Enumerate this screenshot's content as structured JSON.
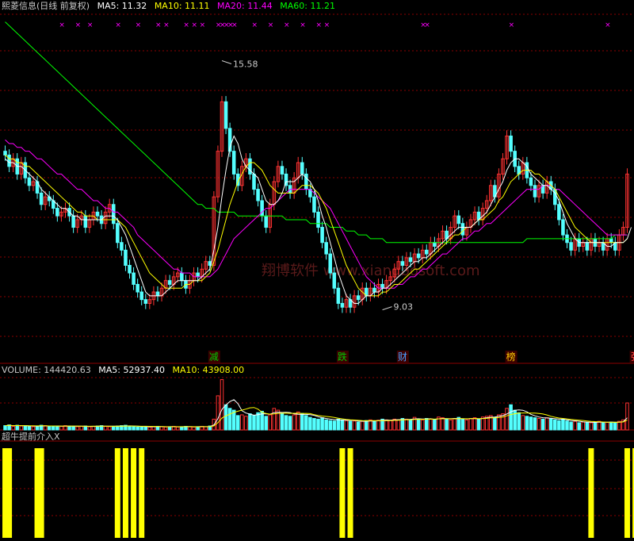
{
  "header": {
    "title": "熙菱信息(日线 前复权)",
    "ma5_label": "MA5: 11.32",
    "ma10_label": "MA10: 11.11",
    "ma20_label": "MA20: 11.44",
    "ma60_label": "MA60: 11.21"
  },
  "volume_header": {
    "label": "VOLUME: 144420.63",
    "ma5_label": "MA5: 52937.40",
    "ma10_label": "MA10: 43908.00"
  },
  "indicator_header": {
    "label": "超牛提前介入X"
  },
  "watermark": "翔博软件 www.xiangbosoft.com",
  "tags": [
    {
      "text": "减",
      "color": "#00cc00",
      "bg": "#3a0000",
      "x_index": 52
    },
    {
      "text": "跌",
      "color": "#00cc00",
      "bg": "#3a0000",
      "x_index": 84
    },
    {
      "text": "财",
      "color": "#4aa0ff",
      "bg": "#3a0000",
      "x_index": 99
    },
    {
      "text": "榜",
      "color": "#ffcc00",
      "bg": "#3a0000",
      "x_index": 126
    },
    {
      "text": "张",
      "color": "#ff4040",
      "bg": "#3a0000",
      "x_index": 157
    }
  ],
  "colors": {
    "up": "#ff3232",
    "down": "#54ffff",
    "ma5": "#ffffff",
    "ma10": "#ffff00",
    "ma20": "#ff00ff",
    "ma60": "#00ff00",
    "grid": "#8b0000",
    "signal": "#ffff00",
    "marker": "#ff00ff"
  },
  "chart_data": {
    "type": "candlestick",
    "price_annotations": [
      {
        "text": "15.58",
        "value": 15.58
      },
      {
        "text": "9.03",
        "value": 9.03
      }
    ],
    "ylim": [
      8.0,
      16.8
    ],
    "volume_ylim": [
      0,
      150000
    ],
    "bars": [
      [
        13.2,
        13.1
      ],
      [
        13.1,
        12.8
      ],
      [
        12.8,
        13.0
      ],
      [
        13.0,
        12.6
      ],
      [
        12.6,
        12.9
      ],
      [
        12.9,
        12.5
      ],
      [
        12.5,
        12.3
      ],
      [
        12.3,
        12.4
      ],
      [
        12.4,
        12.1
      ],
      [
        12.1,
        11.8
      ],
      [
        11.8,
        12.0
      ],
      [
        12.0,
        11.9
      ],
      [
        11.9,
        11.7
      ],
      [
        11.7,
        11.5
      ],
      [
        11.5,
        11.6
      ],
      [
        11.6,
        11.7
      ],
      [
        11.7,
        11.5
      ],
      [
        11.5,
        11.2
      ],
      [
        11.2,
        11.4
      ],
      [
        11.4,
        11.5
      ],
      [
        11.5,
        11.2
      ],
      [
        11.2,
        11.4
      ],
      [
        11.4,
        11.6
      ],
      [
        11.6,
        11.5
      ],
      [
        11.5,
        11.3
      ],
      [
        11.3,
        11.6
      ],
      [
        11.6,
        11.8
      ],
      [
        11.8,
        11.3
      ],
      [
        11.3,
        10.8
      ],
      [
        10.8,
        10.6
      ],
      [
        10.6,
        10.2
      ],
      [
        10.2,
        10.0
      ],
      [
        10.0,
        9.7
      ],
      [
        9.7,
        9.5
      ],
      [
        9.5,
        9.3
      ],
      [
        9.3,
        9.2
      ],
      [
        9.2,
        9.3
      ],
      [
        9.3,
        9.5
      ],
      [
        9.5,
        9.4
      ],
      [
        9.4,
        9.6
      ],
      [
        9.6,
        9.8
      ],
      [
        9.8,
        9.7
      ],
      [
        9.7,
        9.9
      ],
      [
        9.9,
        10.0
      ],
      [
        10.0,
        9.8
      ],
      [
        9.8,
        9.6
      ],
      [
        9.6,
        9.8
      ],
      [
        9.8,
        10.0
      ],
      [
        10.0,
        9.9
      ],
      [
        9.9,
        10.1
      ],
      [
        10.1,
        10.3
      ],
      [
        10.3,
        10.2
      ],
      [
        10.2,
        12.0
      ],
      [
        12.0,
        13.2
      ],
      [
        13.2,
        14.5
      ],
      [
        14.5,
        13.8
      ],
      [
        13.8,
        13.2
      ],
      [
        13.2,
        12.6
      ],
      [
        12.6,
        12.3
      ],
      [
        12.3,
        12.8
      ],
      [
        12.8,
        13.0
      ],
      [
        13.0,
        12.6
      ],
      [
        12.6,
        12.2
      ],
      [
        12.2,
        11.9
      ],
      [
        11.9,
        11.5
      ],
      [
        11.5,
        11.2
      ],
      [
        11.2,
        11.8
      ],
      [
        11.8,
        12.4
      ],
      [
        12.4,
        12.8
      ],
      [
        12.8,
        12.6
      ],
      [
        12.6,
        12.3
      ],
      [
        12.3,
        12.1
      ],
      [
        12.1,
        12.5
      ],
      [
        12.5,
        12.9
      ],
      [
        12.9,
        12.6
      ],
      [
        12.6,
        12.2
      ],
      [
        12.2,
        12.0
      ],
      [
        12.0,
        11.6
      ],
      [
        11.6,
        11.2
      ],
      [
        11.2,
        10.8
      ],
      [
        10.8,
        10.5
      ],
      [
        10.5,
        10.0
      ],
      [
        10.0,
        9.6
      ],
      [
        9.6,
        9.2
      ],
      [
        9.2,
        9.1
      ],
      [
        9.1,
        9.3
      ],
      [
        9.3,
        9.1
      ],
      [
        9.1,
        9.4
      ],
      [
        9.4,
        9.3
      ],
      [
        9.3,
        9.6
      ],
      [
        9.6,
        9.4
      ],
      [
        9.4,
        9.6
      ],
      [
        9.6,
        9.5
      ],
      [
        9.5,
        9.7
      ],
      [
        9.7,
        9.6
      ],
      [
        9.6,
        9.8
      ],
      [
        9.8,
        9.9
      ],
      [
        9.9,
        10.1
      ],
      [
        10.1,
        10.3
      ],
      [
        10.3,
        10.2
      ],
      [
        10.2,
        10.4
      ],
      [
        10.4,
        10.3
      ],
      [
        10.3,
        10.5
      ],
      [
        10.5,
        10.4
      ],
      [
        10.4,
        10.6
      ],
      [
        10.6,
        10.5
      ],
      [
        10.5,
        10.8
      ],
      [
        10.8,
        10.7
      ],
      [
        10.7,
        10.9
      ],
      [
        10.9,
        11.1
      ],
      [
        11.1,
        10.9
      ],
      [
        10.9,
        11.2
      ],
      [
        11.2,
        11.5
      ],
      [
        11.5,
        11.3
      ],
      [
        11.3,
        11.0
      ],
      [
        11.0,
        11.2
      ],
      [
        11.2,
        11.4
      ],
      [
        11.4,
        11.6
      ],
      [
        11.6,
        11.4
      ],
      [
        11.4,
        11.7
      ],
      [
        11.7,
        11.9
      ],
      [
        11.9,
        12.3
      ],
      [
        12.3,
        12.0
      ],
      [
        12.0,
        12.6
      ],
      [
        12.6,
        13.0
      ],
      [
        13.0,
        13.6
      ],
      [
        13.6,
        13.2
      ],
      [
        13.2,
        12.8
      ],
      [
        12.8,
        12.6
      ],
      [
        12.6,
        12.9
      ],
      [
        12.9,
        12.5
      ],
      [
        12.5,
        12.3
      ],
      [
        12.3,
        12.0
      ],
      [
        12.0,
        12.3
      ],
      [
        12.3,
        12.1
      ],
      [
        12.1,
        12.4
      ],
      [
        12.4,
        12.2
      ],
      [
        12.2,
        11.8
      ],
      [
        11.8,
        11.4
      ],
      [
        11.4,
        11.0
      ],
      [
        11.0,
        10.8
      ],
      [
        10.8,
        10.6
      ],
      [
        10.6,
        10.9
      ],
      [
        10.9,
        10.7
      ],
      [
        10.7,
        10.8
      ],
      [
        10.8,
        10.6
      ],
      [
        10.6,
        10.9
      ],
      [
        10.9,
        10.7
      ],
      [
        10.7,
        10.8
      ],
      [
        10.8,
        10.6
      ],
      [
        10.6,
        10.9
      ],
      [
        10.9,
        10.8
      ],
      [
        10.8,
        10.6
      ],
      [
        10.6,
        11.0
      ],
      [
        11.0,
        11.2
      ],
      [
        11.2,
        12.6
      ]
    ],
    "volumes": [
      12,
      14,
      10,
      13,
      11,
      12,
      10,
      9,
      11,
      13,
      12,
      10,
      9,
      11,
      10,
      12,
      11,
      10,
      9,
      10,
      11,
      9,
      10,
      11,
      12,
      10,
      9,
      10,
      11,
      12,
      13,
      10,
      9,
      8,
      9,
      10,
      8,
      9,
      10,
      9,
      8,
      9,
      10,
      8,
      9,
      10,
      9,
      8,
      9,
      10,
      9,
      11,
      30,
      95,
      140,
      70,
      60,
      55,
      40,
      42,
      38,
      45,
      40,
      48,
      52,
      38,
      42,
      60,
      55,
      48,
      40,
      38,
      42,
      50,
      46,
      40,
      35,
      32,
      30,
      34,
      28,
      26,
      25,
      30,
      28,
      26,
      24,
      25,
      22,
      24,
      26,
      28,
      25,
      27,
      30,
      28,
      26,
      30,
      28,
      32,
      30,
      28,
      35,
      30,
      28,
      32,
      30,
      28,
      36,
      34,
      30,
      28,
      32,
      35,
      30,
      28,
      32,
      34,
      30,
      36,
      38,
      40,
      35,
      42,
      45,
      60,
      70,
      55,
      48,
      40,
      38,
      36,
      34,
      32,
      30,
      34,
      32,
      28,
      26,
      30,
      25,
      22,
      24,
      20,
      22,
      21,
      20,
      22,
      24,
      20,
      21,
      22,
      20,
      24,
      28,
      75
    ],
    "ma5": [
      13.0,
      12.9,
      12.9,
      12.8,
      12.8,
      12.7,
      12.6,
      12.5,
      12.4,
      12.2,
      12.1,
      12.0,
      11.9,
      11.8,
      11.7,
      11.7,
      11.6,
      11.5,
      11.5,
      11.4,
      11.4,
      11.4,
      11.4,
      11.4,
      11.4,
      11.5,
      11.5,
      11.5,
      11.4,
      11.2,
      11.0,
      10.7,
      10.4,
      10.1,
      9.8,
      9.5,
      9.4,
      9.4,
      9.4,
      9.4,
      9.5,
      9.6,
      9.7,
      9.8,
      9.8,
      9.8,
      9.8,
      9.8,
      9.8,
      9.9,
      10.0,
      10.1,
      10.6,
      11.2,
      12.0,
      12.7,
      13.3,
      13.6,
      13.4,
      13.0,
      12.8,
      12.7,
      12.6,
      12.5,
      12.2,
      11.9,
      11.8,
      11.8,
      11.9,
      12.1,
      12.4,
      12.4,
      12.4,
      12.5,
      12.6,
      12.5,
      12.4,
      12.2,
      11.9,
      11.5,
      11.2,
      10.8,
      10.4,
      10.0,
      9.7,
      9.4,
      9.3,
      9.2,
      9.2,
      9.3,
      9.4,
      9.4,
      9.5,
      9.5,
      9.6,
      9.6,
      9.7,
      9.8,
      9.9,
      10.0,
      10.1,
      10.2,
      10.3,
      10.3,
      10.4,
      10.4,
      10.5,
      10.6,
      10.7,
      10.8,
      10.9,
      11.0,
      11.1,
      11.2,
      11.2,
      11.2,
      11.2,
      11.3,
      11.4,
      11.5,
      11.6,
      11.8,
      12.0,
      12.2,
      12.4,
      12.7,
      12.9,
      13.0,
      13.0,
      12.9,
      12.8,
      12.6,
      12.5,
      12.4,
      12.3,
      12.3,
      12.2,
      12.1,
      11.9,
      11.6,
      11.3,
      11.1,
      10.9,
      10.8,
      10.8,
      10.8,
      10.8,
      10.8,
      10.8,
      10.8,
      10.7,
      10.7,
      10.8,
      10.8,
      10.8,
      10.9,
      11.2
    ],
    "ma10": [
      13.1,
      13.0,
      13.0,
      12.9,
      12.9,
      12.8,
      12.8,
      12.7,
      12.6,
      12.5,
      12.4,
      12.3,
      12.2,
      12.1,
      12.0,
      11.9,
      11.8,
      11.7,
      11.6,
      11.6,
      11.5,
      11.5,
      11.5,
      11.4,
      11.4,
      11.4,
      11.4,
      11.4,
      11.4,
      11.3,
      11.2,
      11.0,
      10.8,
      10.6,
      10.4,
      10.2,
      10.0,
      9.9,
      9.8,
      9.7,
      9.6,
      9.6,
      9.6,
      9.6,
      9.6,
      9.7,
      9.7,
      9.8,
      9.8,
      9.8,
      9.9,
      10.0,
      10.3,
      10.6,
      11.0,
      11.4,
      11.8,
      12.1,
      12.4,
      12.6,
      12.8,
      12.9,
      12.9,
      12.8,
      12.7,
      12.5,
      12.3,
      12.2,
      12.1,
      12.1,
      12.1,
      12.1,
      12.1,
      12.2,
      12.3,
      12.3,
      12.3,
      12.2,
      12.1,
      11.9,
      11.7,
      11.4,
      11.1,
      10.8,
      10.5,
      10.2,
      10.0,
      9.8,
      9.6,
      9.5,
      9.4,
      9.4,
      9.4,
      9.4,
      9.5,
      9.5,
      9.6,
      9.7,
      9.7,
      9.8,
      9.9,
      10.0,
      10.1,
      10.1,
      10.2,
      10.3,
      10.4,
      10.5,
      10.6,
      10.7,
      10.8,
      10.9,
      11.0,
      11.0,
      11.1,
      11.2,
      11.2,
      11.3,
      11.4,
      11.4,
      11.5,
      11.6,
      11.7,
      11.9,
      12.0,
      12.2,
      12.4,
      12.5,
      12.6,
      12.7,
      12.7,
      12.7,
      12.6,
      12.6,
      12.5,
      12.4,
      12.3,
      12.2,
      12.0,
      11.8,
      11.6,
      11.4,
      11.2,
      11.1,
      11.0,
      10.9,
      10.8,
      10.8,
      10.8,
      10.8,
      10.8,
      10.8,
      10.8,
      10.8,
      10.8,
      10.9
    ],
    "ma20": [
      13.5,
      13.4,
      13.4,
      13.3,
      13.3,
      13.2,
      13.2,
      13.1,
      13.0,
      13.0,
      12.9,
      12.8,
      12.7,
      12.6,
      12.6,
      12.5,
      12.4,
      12.3,
      12.2,
      12.2,
      12.1,
      12.0,
      11.9,
      11.9,
      11.8,
      11.7,
      11.7,
      11.6,
      11.6,
      11.5,
      11.4,
      11.3,
      11.2,
      11.0,
      10.9,
      10.8,
      10.7,
      10.6,
      10.5,
      10.4,
      10.3,
      10.2,
      10.1,
      10.1,
      10.0,
      10.0,
      10.0,
      9.9,
      9.9,
      9.9,
      9.9,
      9.9,
      10.0,
      10.1,
      10.3,
      10.5,
      10.7,
      10.9,
      11.0,
      11.1,
      11.2,
      11.3,
      11.4,
      11.5,
      11.6,
      11.7,
      11.7,
      11.8,
      11.9,
      12.0,
      12.1,
      12.2,
      12.2,
      12.2,
      12.2,
      12.2,
      12.2,
      12.1,
      12.0,
      11.9,
      11.8,
      11.7,
      11.5,
      11.3,
      11.1,
      10.9,
      10.7,
      10.5,
      10.3,
      10.1,
      9.9,
      9.8,
      9.7,
      9.6,
      9.6,
      9.6,
      9.6,
      9.6,
      9.7,
      9.7,
      9.8,
      9.9,
      9.9,
      10.0,
      10.1,
      10.1,
      10.2,
      10.3,
      10.4,
      10.5,
      10.5,
      10.6,
      10.7,
      10.8,
      10.9,
      10.9,
      11.0,
      11.1,
      11.1,
      11.2,
      11.3,
      11.3,
      11.4,
      11.5,
      11.6,
      11.7,
      11.8,
      11.9,
      12.0,
      12.1,
      12.2,
      12.2,
      12.2,
      12.2,
      12.3,
      12.3,
      12.3,
      12.2,
      12.2,
      12.1,
      12.0,
      11.9,
      11.8,
      11.7,
      11.6,
      11.5,
      11.4,
      11.3,
      11.2,
      11.1,
      11.0,
      11.0,
      11.0,
      11.0,
      11.0,
      11.0
    ],
    "ma60": [
      16.6,
      16.5,
      16.4,
      16.3,
      16.2,
      16.1,
      16.0,
      15.9,
      15.8,
      15.7,
      15.6,
      15.5,
      15.4,
      15.3,
      15.2,
      15.1,
      15.0,
      14.9,
      14.8,
      14.7,
      14.6,
      14.5,
      14.4,
      14.3,
      14.2,
      14.1,
      14.0,
      13.9,
      13.8,
      13.7,
      13.6,
      13.5,
      13.4,
      13.3,
      13.2,
      13.1,
      13.0,
      12.9,
      12.8,
      12.7,
      12.6,
      12.5,
      12.4,
      12.3,
      12.2,
      12.1,
      12.0,
      11.9,
      11.8,
      11.8,
      11.7,
      11.7,
      11.7,
      11.6,
      11.6,
      11.6,
      11.6,
      11.6,
      11.5,
      11.5,
      11.5,
      11.5,
      11.5,
      11.5,
      11.5,
      11.5,
      11.5,
      11.5,
      11.5,
      11.5,
      11.4,
      11.4,
      11.4,
      11.4,
      11.4,
      11.4,
      11.3,
      11.3,
      11.3,
      11.3,
      11.3,
      11.2,
      11.2,
      11.2,
      11.2,
      11.1,
      11.1,
      11.1,
      11.0,
      11.0,
      11.0,
      10.9,
      10.9,
      10.9,
      10.9,
      10.8,
      10.8,
      10.8,
      10.8,
      10.8,
      10.8,
      10.8,
      10.8,
      10.8,
      10.8,
      10.8,
      10.8,
      10.8,
      10.8,
      10.8,
      10.8,
      10.8,
      10.8,
      10.8,
      10.8,
      10.8,
      10.8,
      10.8,
      10.8,
      10.8,
      10.8,
      10.8,
      10.8,
      10.8,
      10.8,
      10.8,
      10.8,
      10.8,
      10.8,
      10.8,
      10.9,
      10.9,
      10.9,
      10.9,
      10.9,
      10.9,
      10.9,
      10.9,
      10.9,
      10.9,
      10.9,
      10.9,
      10.9,
      10.9,
      10.9,
      10.9,
      10.9,
      10.9,
      10.9,
      10.9,
      10.9,
      10.9,
      11.0,
      11.0,
      11.0,
      11.0
    ],
    "signals": [
      0,
      0,
      0,
      0,
      0,
      0,
      0,
      0,
      0,
      0,
      0,
      0,
      0,
      0,
      0,
      0,
      0,
      0,
      0,
      0,
      0,
      0,
      0,
      0,
      0,
      0,
      0,
      0,
      1,
      0,
      1,
      0,
      1,
      0,
      1,
      0,
      0,
      0,
      0,
      0,
      0,
      0,
      0,
      0,
      0,
      0,
      0,
      0,
      0,
      0,
      0,
      0,
      0,
      0,
      0,
      0,
      0,
      0,
      0,
      0,
      0,
      0,
      0,
      0,
      0,
      0,
      0,
      0,
      0,
      0,
      0,
      0,
      0,
      0,
      0,
      0,
      0,
      0,
      0,
      0,
      0,
      0,
      0,
      0,
      1,
      0,
      1,
      0,
      0,
      0,
      0,
      0,
      0,
      0,
      0,
      0,
      0,
      0,
      0,
      0,
      0,
      0,
      0,
      0,
      0,
      0,
      0,
      0,
      0,
      0,
      0,
      0,
      0,
      0,
      0,
      0,
      0,
      0,
      0,
      0,
      0,
      0,
      0,
      0,
      0,
      0,
      0,
      0,
      0,
      0,
      0,
      0,
      0,
      0,
      0,
      0,
      0,
      0,
      0,
      0,
      0,
      0,
      0,
      0,
      0,
      0,
      0,
      0,
      0,
      0,
      0,
      0,
      0,
      0,
      0,
      0,
      0,
      0,
      0,
      0
    ],
    "signals_extra": [
      0,
      1,
      8,
      9,
      146,
      155,
      157
    ],
    "markers": [
      14,
      18,
      21,
      28,
      33,
      38,
      40,
      45,
      47,
      49,
      53,
      54,
      55,
      56,
      57,
      62,
      66,
      70,
      74,
      78,
      80,
      104,
      105,
      126,
      150,
      157
    ]
  }
}
